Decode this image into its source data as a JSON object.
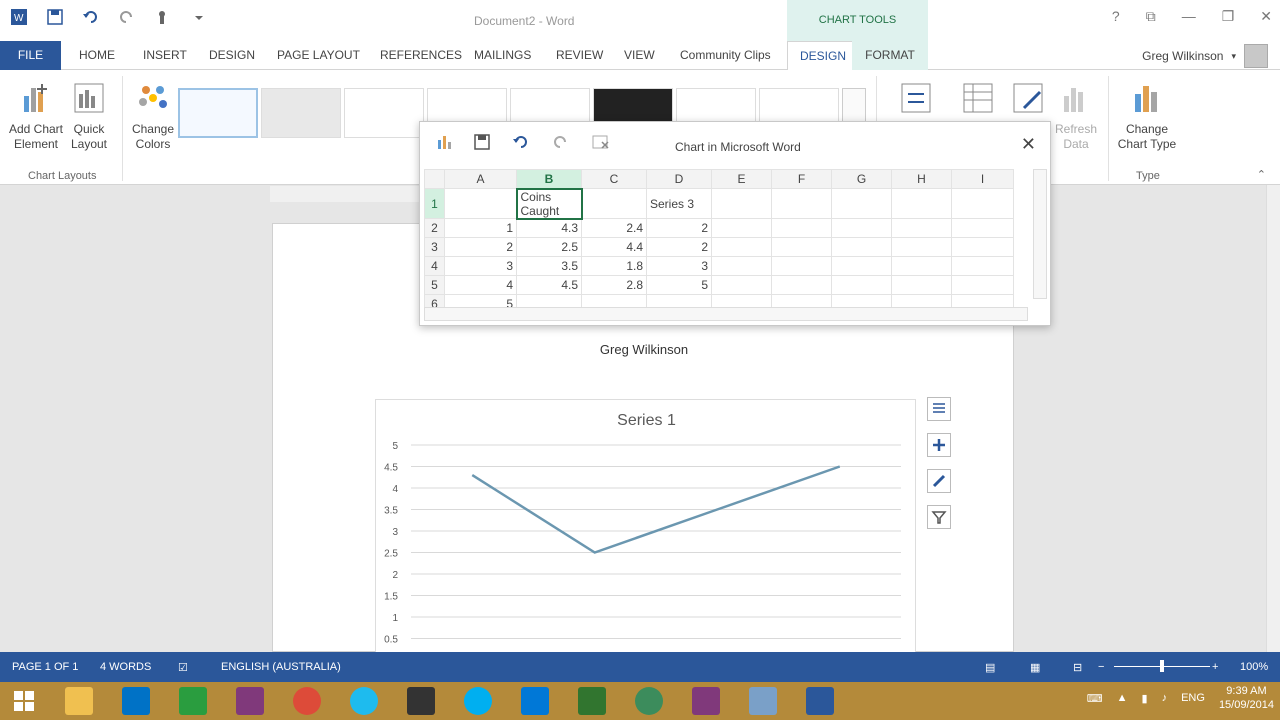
{
  "window": {
    "title": "Document2 - Word",
    "context_tab_group": "CHART TOOLS"
  },
  "tabs": [
    "FILE",
    "HOME",
    "INSERT",
    "DESIGN",
    "PAGE LAYOUT",
    "REFERENCES",
    "MAILINGS",
    "REVIEW",
    "VIEW",
    "Community Clips",
    "DESIGN",
    "FORMAT"
  ],
  "user": {
    "name": "Greg Wilkinson"
  },
  "ribbon": {
    "add_chart_element": "Add Chart",
    "add_chart_element2": "Element",
    "quick_layout": "Quick",
    "quick_layout2": "Layout",
    "change_colors": "Change",
    "change_colors2": "Colors",
    "group_chart_layouts": "Chart Layouts",
    "refresh_data": "Refresh",
    "refresh_data2": "Data",
    "change_chart_type": "Change",
    "change_chart_type2": "Chart Type",
    "group_type": "Type"
  },
  "data_window": {
    "title": "Chart in Microsoft Word",
    "columns": [
      "A",
      "B",
      "C",
      "D",
      "E",
      "F",
      "G",
      "H",
      "I"
    ],
    "rows": [
      {
        "num": "1",
        "cells": [
          "",
          "Coins Caught",
          "",
          "Series 3",
          "",
          "",
          "",
          "",
          ""
        ]
      },
      {
        "num": "2",
        "cells": [
          "1",
          "4.3",
          "2.4",
          "2",
          "",
          "",
          "",
          "",
          ""
        ]
      },
      {
        "num": "3",
        "cells": [
          "2",
          "2.5",
          "4.4",
          "2",
          "",
          "",
          "",
          "",
          ""
        ]
      },
      {
        "num": "4",
        "cells": [
          "3",
          "3.5",
          "1.8",
          "3",
          "",
          "",
          "",
          "",
          ""
        ]
      },
      {
        "num": "5",
        "cells": [
          "4",
          "4.5",
          "2.8",
          "5",
          "",
          "",
          "",
          "",
          ""
        ]
      },
      {
        "num": "6",
        "cells": [
          "5",
          "",
          "",
          "",
          "",
          "",
          "",
          "",
          ""
        ]
      }
    ]
  },
  "document": {
    "author": "Greg Wilkinson"
  },
  "chart_data": {
    "type": "line",
    "title": "Series 1",
    "x": [
      1,
      2,
      3,
      4
    ],
    "series": [
      {
        "name": "Series 1",
        "values": [
          4.3,
          2.5,
          3.5,
          4.5
        ]
      }
    ],
    "ylim": [
      0,
      5
    ],
    "yticks": [
      "5",
      "4.5",
      "4",
      "3.5",
      "3",
      "2.5",
      "2",
      "1.5",
      "1",
      "0.5"
    ],
    "grid": true,
    "line_color": "#6b97b0"
  },
  "status": {
    "page": "PAGE 1 OF 1",
    "words": "4 WORDS",
    "language": "ENGLISH (AUSTRALIA)",
    "zoom": "100%"
  },
  "taskbar": {
    "lang": "ENG",
    "time": "9:39 AM",
    "date": "15/09/2014"
  },
  "colors": {
    "word_blue": "#2b579a",
    "chart_tools_bg": "#dff2ee",
    "excel_green": "#217346"
  }
}
